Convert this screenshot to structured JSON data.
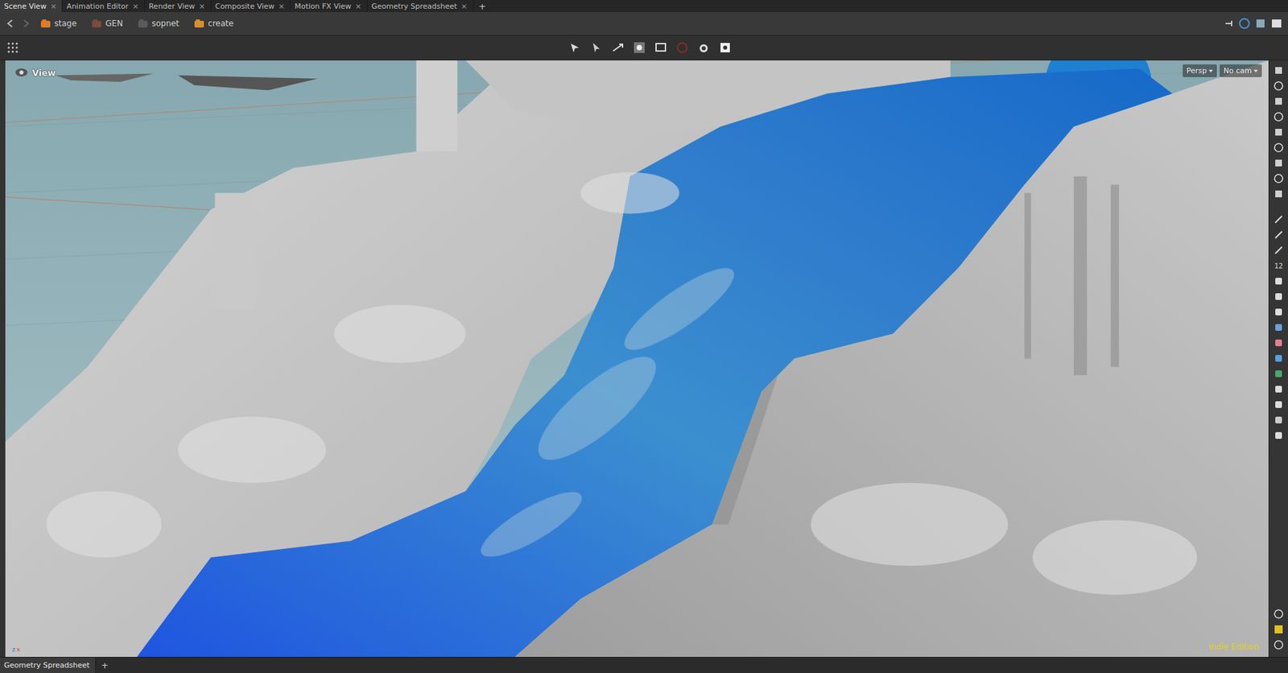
{
  "tabs": [
    {
      "label": "Scene View",
      "close": "×",
      "selected": true
    },
    {
      "label": "Animation Editor",
      "close": "×",
      "selected": false
    },
    {
      "label": "Render View",
      "close": "×",
      "selected": false
    },
    {
      "label": "Composite View",
      "close": "×",
      "selected": false
    },
    {
      "label": "Motion FX View",
      "close": "×",
      "selected": false
    },
    {
      "label": "Geometry Spreadsheet",
      "close": "×",
      "selected": false
    }
  ],
  "add_tab": "+",
  "path": [
    {
      "label": "stage",
      "color": "#e07b2a"
    },
    {
      "label": "GEN",
      "color": "#7a4a3a"
    },
    {
      "label": "sopnet",
      "color": "#5a5a5a"
    },
    {
      "label": "create",
      "color": "#d9902a"
    }
  ],
  "viewport": {
    "label": "View",
    "projection": "Persp",
    "camera": "No cam",
    "watermark": "Indie Edition",
    "axes": [
      "z",
      "x"
    ]
  },
  "right_tools": {
    "snap_label": "12"
  },
  "bottom_tabs": [
    {
      "label": "Geometry Spreadsheet",
      "selected": true
    }
  ],
  "bottom_add": "+"
}
